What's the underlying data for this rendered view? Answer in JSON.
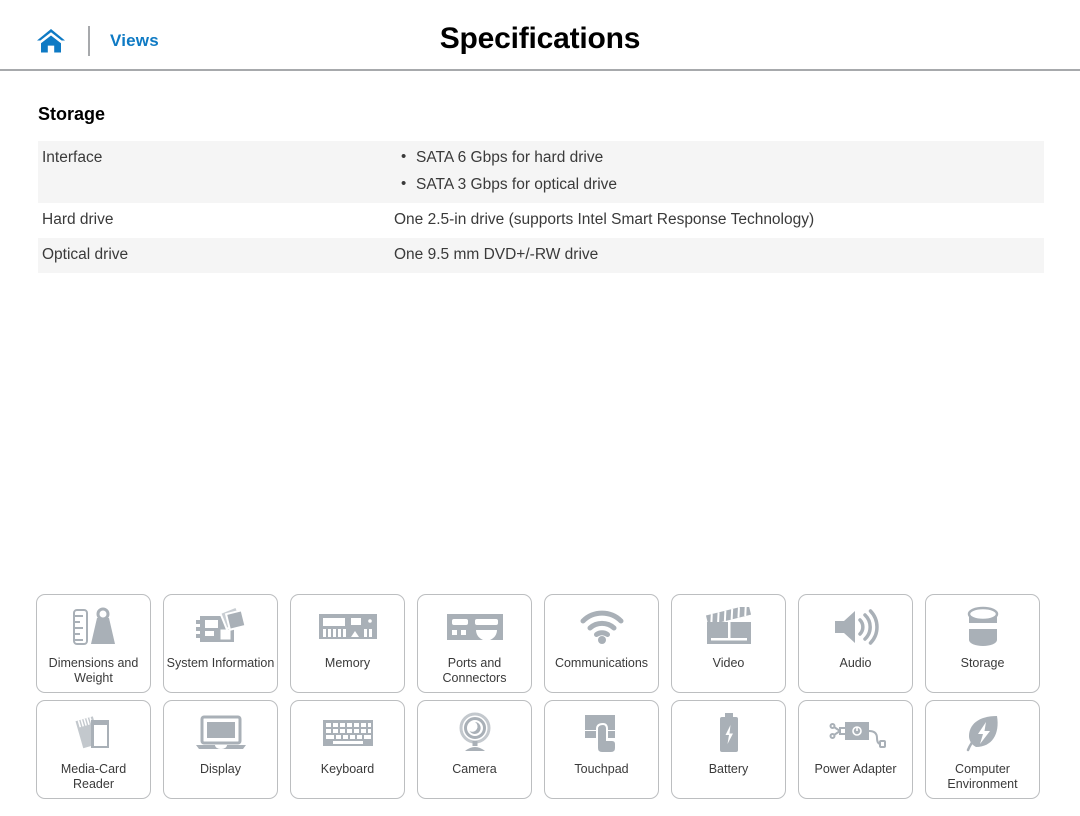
{
  "header": {
    "home_icon": "home-icon",
    "views_label": "Views",
    "title": "Specifications",
    "accent_color": "#0e7ac4",
    "rule_color": "#a7a9ac"
  },
  "section": {
    "title": "Storage",
    "rows": [
      {
        "label": "Interface",
        "bullets": [
          "SATA 6 Gbps for hard drive",
          "SATA 3 Gbps for optical drive"
        ],
        "shaded": true
      },
      {
        "label": "Hard drive",
        "value": "One 2.5-in drive (supports Intel Smart Response Technology)",
        "shaded": false
      },
      {
        "label": "Optical drive",
        "value": "One 9.5 mm DVD+/-RW drive",
        "shaded": true
      }
    ],
    "shade_color": "#f5f5f5"
  },
  "tiles": [
    {
      "icon": "ruler-weight-icon",
      "label": "Dimensions and Weight"
    },
    {
      "icon": "motherboard-icon",
      "label": "System Information"
    },
    {
      "icon": "memory-module-icon",
      "label": "Memory"
    },
    {
      "icon": "ports-connectors-icon",
      "label": "Ports and Connectors"
    },
    {
      "icon": "wifi-icon",
      "label": "Communications"
    },
    {
      "icon": "clapperboard-icon",
      "label": "Video"
    },
    {
      "icon": "speaker-icon",
      "label": "Audio"
    },
    {
      "icon": "hard-drive-cylinder-icon",
      "label": "Storage"
    },
    {
      "icon": "media-card-icon",
      "label": "Media-Card Reader"
    },
    {
      "icon": "laptop-display-icon",
      "label": "Display"
    },
    {
      "icon": "keyboard-icon",
      "label": "Keyboard"
    },
    {
      "icon": "webcam-icon",
      "label": "Camera"
    },
    {
      "icon": "touchpad-hand-icon",
      "label": "Touchpad"
    },
    {
      "icon": "battery-icon",
      "label": "Battery"
    },
    {
      "icon": "power-adapter-icon",
      "label": "Power Adapter"
    },
    {
      "icon": "leaf-bolt-icon",
      "label": "Computer Environment"
    }
  ],
  "icon_color": "#a9b0b7",
  "tile_border_color": "#bcbec0"
}
